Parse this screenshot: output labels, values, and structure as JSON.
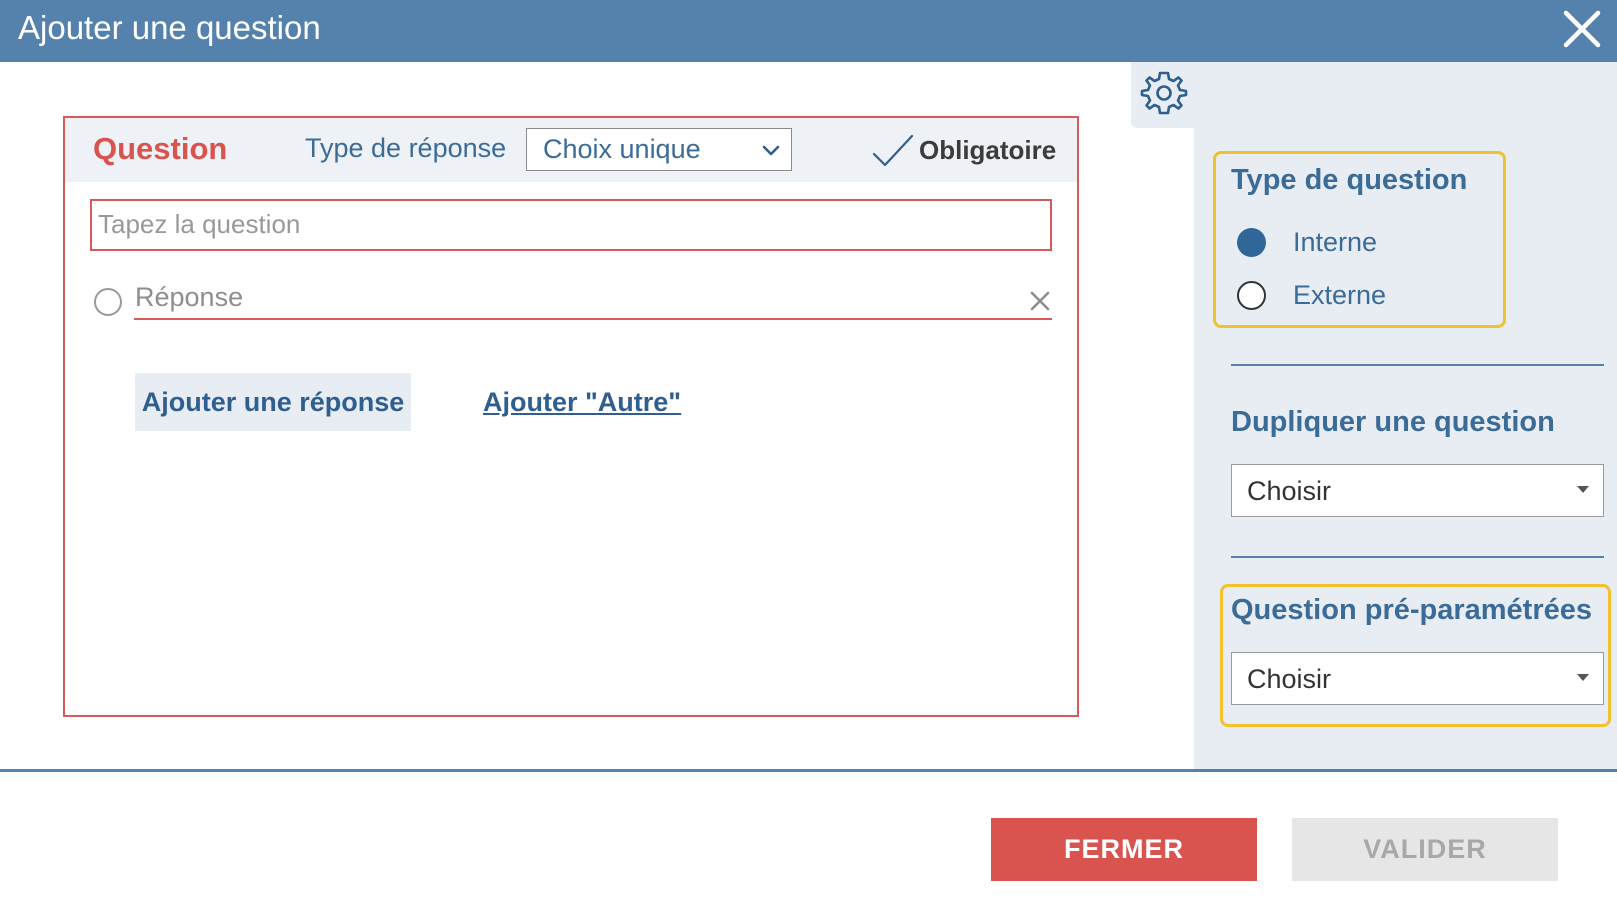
{
  "dialog": {
    "title": "Ajouter une question",
    "header_color": "#5482ad"
  },
  "question_card": {
    "question_label": "Question",
    "type_label": "Type de réponse",
    "type_select_value": "Choix unique",
    "required_label": "Obligatoire",
    "question_placeholder": "Tapez la question",
    "answer_placeholder": "Réponse",
    "add_answer_label": "Ajouter une réponse",
    "add_other_label": "Ajouter \"Autre\"",
    "border_color": "#d65a5a"
  },
  "sidebar": {
    "question_type": {
      "title": "Type de question",
      "options": [
        {
          "label": "Interne",
          "selected": true
        },
        {
          "label": "Externe",
          "selected": false
        }
      ]
    },
    "duplicate": {
      "title": "Dupliquer une question",
      "select_value": "Choisir"
    },
    "preset": {
      "title": "Question pré-paramétrées",
      "select_value": "Choisir"
    },
    "highlight_color": "#f2c12e"
  },
  "footer": {
    "close_label": "FERMER",
    "validate_label": "VALIDER",
    "close_color": "#d9534f"
  }
}
